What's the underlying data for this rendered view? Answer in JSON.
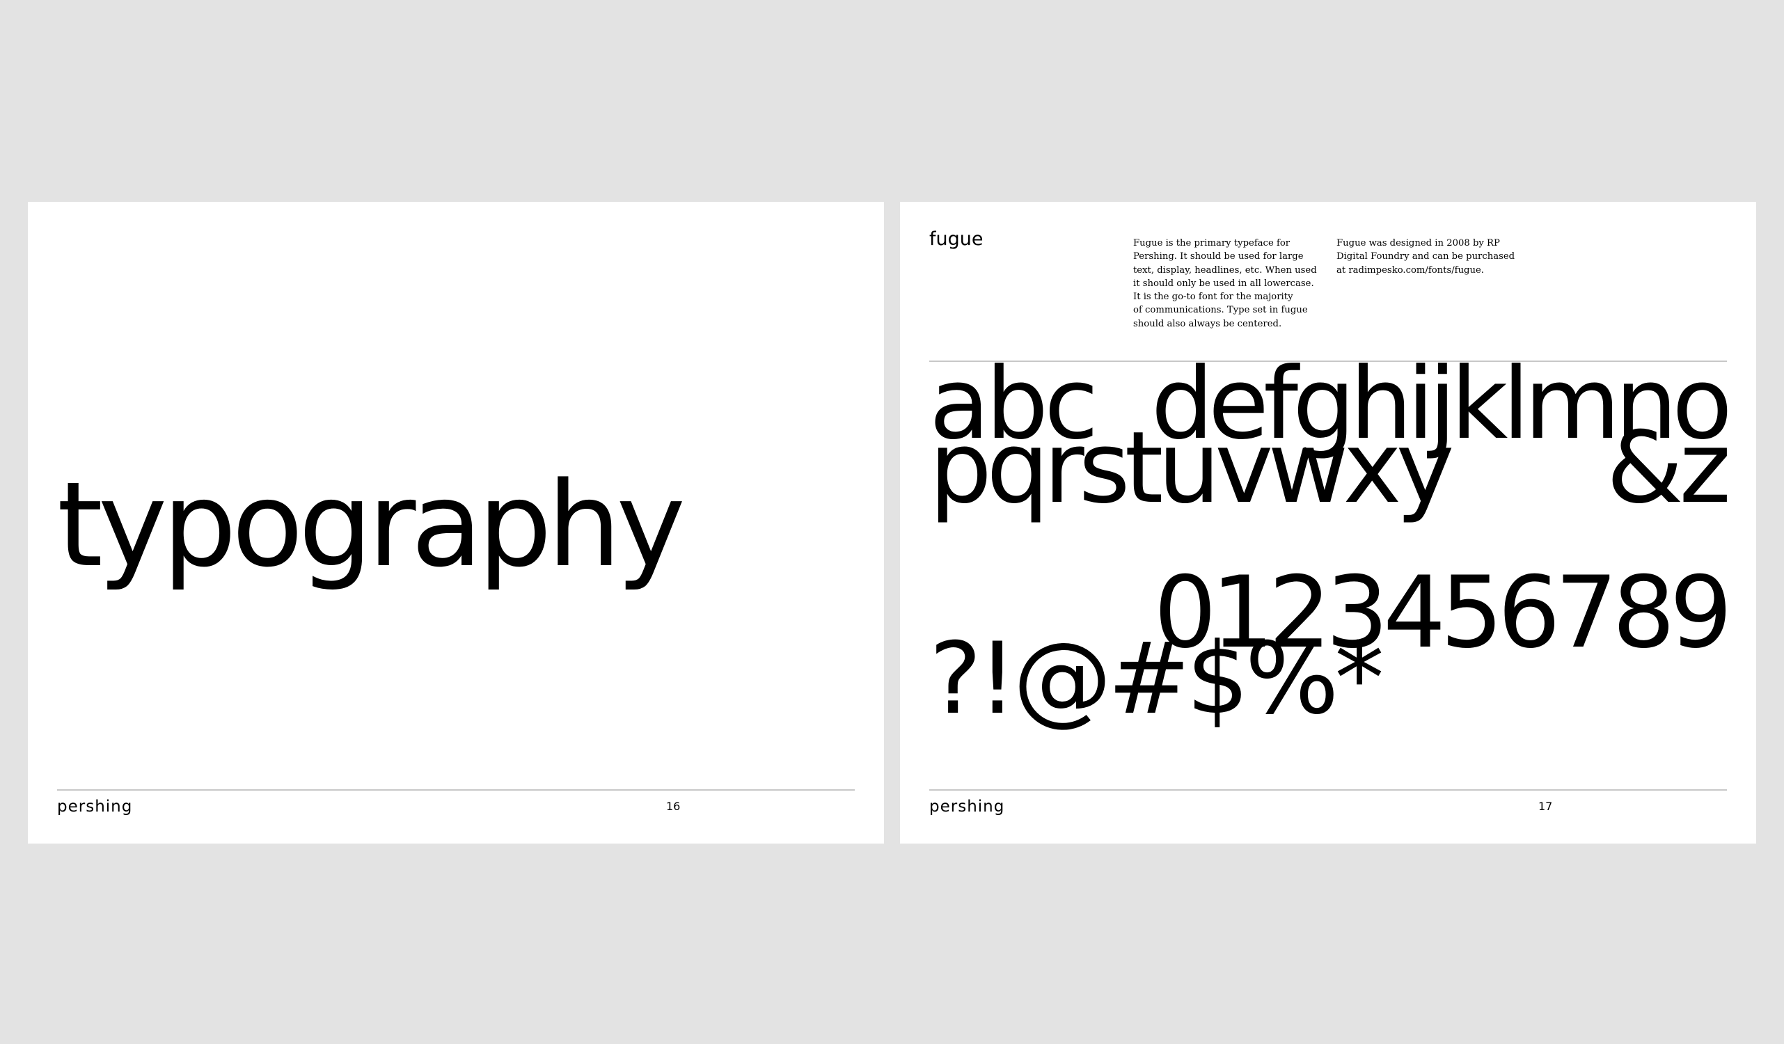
{
  "left_page": {
    "title": "typography",
    "footer": {
      "brand": "pershing",
      "page_number": "16"
    }
  },
  "right_page": {
    "font_name": "fugue",
    "description_1": "Fugue is the primary typeface for\nPershing. It should be used for large\ntext, display, headlines, etc. When used\nit should only be used in all lowercase.\nIt is the go-to font for the majority\nof communications. Type set in fugue\nshould also always be centered.",
    "description_2": "Fugue was designed in 2008 by RP\nDigital Foundry and can be purchased\nat radimpesko.com/fonts/fugue.",
    "specimen": {
      "row_1_left": "abc",
      "row_1_right": "defghijklmno",
      "row_2_left": "pqrstuvwxy",
      "row_2_right": "&z",
      "row_3": "0123456789",
      "row_4": "?!@#$%*"
    },
    "footer": {
      "brand": "pershing",
      "page_number": "17"
    }
  }
}
